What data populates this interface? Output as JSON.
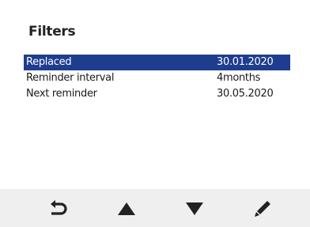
{
  "screen": {
    "title": "Filters"
  },
  "filters": {
    "rows": [
      {
        "label": "Replaced",
        "value": "30.01.2020",
        "selected": true
      },
      {
        "label": "Reminder interval",
        "value": "4months",
        "selected": false
      },
      {
        "label": "Next reminder",
        "value": "30.05.2020",
        "selected": false
      }
    ]
  },
  "toolbar": {
    "buttons": [
      {
        "icon": "back-arrow-icon"
      },
      {
        "icon": "up-triangle-icon"
      },
      {
        "icon": "down-triangle-icon"
      },
      {
        "icon": "pencil-icon"
      }
    ]
  },
  "colors": {
    "selection": "#1e3d8f",
    "toolbar_background": "#efefef",
    "icon": "#222222"
  }
}
